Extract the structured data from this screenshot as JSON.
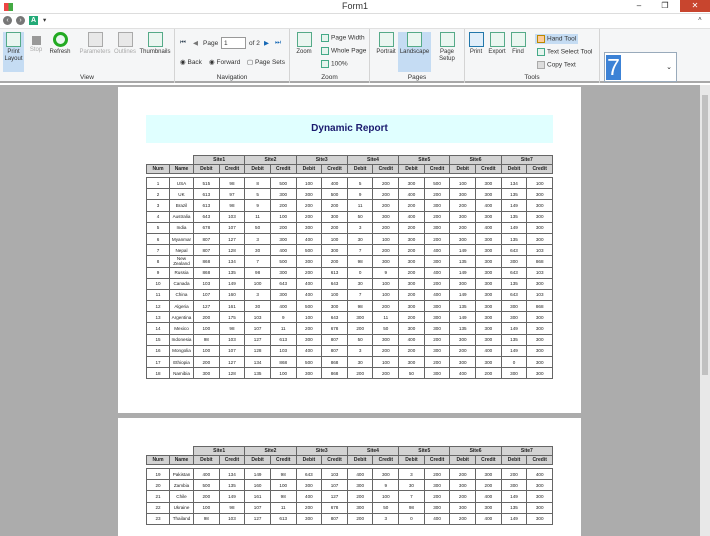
{
  "window": {
    "title": "Form1",
    "minimize": "–",
    "restore": "❐",
    "close": "✕"
  },
  "ribbon": {
    "view": {
      "label": "View",
      "print_layout": "Print Layout",
      "stop": "Stop",
      "refresh": "Refresh",
      "parameters": "Parameters",
      "outlines": "Outlines",
      "thumbnails": "Thumbnails"
    },
    "navigation": {
      "label": "Navigation",
      "page_label": "Page",
      "page_value": "1",
      "of_label": "of 2",
      "back": "Back",
      "forward": "Forward",
      "page_sets": "Page Sets"
    },
    "zoom": {
      "label": "Zoom",
      "zoom": "Zoom",
      "page_width": "Page Width",
      "whole_page": "Whole Page",
      "hundred": "100%"
    },
    "pages": {
      "label": "Pages",
      "portrait": "Portrait",
      "landscape": "Landscape",
      "page_setup": "Page Setup"
    },
    "tools": {
      "label": "Tools",
      "print": "Print",
      "export": "Export",
      "find": "Find",
      "hand_tool": "Hand Tool",
      "text_select": "Text Select Tool",
      "copy_text": "Copy Text"
    },
    "combo_value": "7"
  },
  "report": {
    "title": "Dynamic Report",
    "sites": [
      "Site1",
      "Site2",
      "Site3",
      "Site4",
      "Site5",
      "Site6",
      "Site7"
    ],
    "col_num": "Num",
    "col_name": "Name",
    "debit": "Debit",
    "credit": "Credit",
    "page1_rows": [
      [
        "1",
        "USA",
        "515",
        "98",
        "8",
        "500",
        "100",
        "400",
        "5",
        "200",
        "300",
        "500",
        "100",
        "300",
        "134",
        "100"
      ],
      [
        "2",
        "UK",
        "613",
        "97",
        "5",
        "300",
        "300",
        "500",
        "9",
        "200",
        "400",
        "200",
        "300",
        "300",
        "135",
        "300"
      ],
      [
        "3",
        "Brazil",
        "613",
        "98",
        "9",
        "200",
        "200",
        "200",
        "11",
        "200",
        "200",
        "300",
        "200",
        "400",
        "149",
        "300"
      ],
      [
        "4",
        "Australia",
        "643",
        "103",
        "11",
        "100",
        "200",
        "300",
        "50",
        "300",
        "400",
        "200",
        "300",
        "300",
        "135",
        "300"
      ],
      [
        "5",
        "India",
        "678",
        "107",
        "50",
        "200",
        "300",
        "200",
        "3",
        "200",
        "200",
        "300",
        "200",
        "400",
        "149",
        "300"
      ],
      [
        "6",
        "Myanmar",
        "807",
        "127",
        "3",
        "300",
        "400",
        "100",
        "30",
        "100",
        "300",
        "200",
        "300",
        "300",
        "135",
        "300"
      ],
      [
        "7",
        "Nepal",
        "807",
        "128",
        "30",
        "400",
        "500",
        "300",
        "7",
        "200",
        "200",
        "400",
        "149",
        "300",
        "643",
        "103"
      ],
      [
        "8",
        "New Zealand",
        "868",
        "134",
        "7",
        "500",
        "300",
        "200",
        "98",
        "300",
        "300",
        "300",
        "135",
        "300",
        "300",
        "868"
      ],
      [
        "9",
        "Russia",
        "868",
        "135",
        "98",
        "300",
        "200",
        "613",
        "0",
        "9",
        "200",
        "400",
        "149",
        "300",
        "643",
        "103"
      ],
      [
        "10",
        "Canada",
        "103",
        "149",
        "100",
        "643",
        "400",
        "643",
        "30",
        "100",
        "300",
        "200",
        "300",
        "300",
        "135",
        "300"
      ],
      [
        "11",
        "China",
        "107",
        "160",
        "3",
        "300",
        "400",
        "100",
        "7",
        "100",
        "200",
        "400",
        "149",
        "300",
        "643",
        "103"
      ],
      [
        "12",
        "Algeria",
        "127",
        "161",
        "30",
        "400",
        "500",
        "300",
        "98",
        "200",
        "300",
        "300",
        "135",
        "300",
        "300",
        "868"
      ],
      [
        "13",
        "Argentina",
        "200",
        "175",
        "103",
        "9",
        "100",
        "643",
        "300",
        "11",
        "200",
        "300",
        "149",
        "300",
        "300",
        "300"
      ],
      [
        "14",
        "Mexico",
        "100",
        "98",
        "107",
        "11",
        "200",
        "678",
        "200",
        "50",
        "300",
        "300",
        "135",
        "300",
        "149",
        "300"
      ],
      [
        "15",
        "Indonesia",
        "98",
        "103",
        "127",
        "613",
        "300",
        "807",
        "50",
        "300",
        "400",
        "200",
        "300",
        "300",
        "135",
        "300"
      ],
      [
        "16",
        "Mongolia",
        "100",
        "107",
        "128",
        "103",
        "400",
        "807",
        "3",
        "200",
        "200",
        "300",
        "200",
        "400",
        "149",
        "300"
      ],
      [
        "17",
        "Ethiopia",
        "200",
        "127",
        "134",
        "868",
        "500",
        "868",
        "30",
        "100",
        "300",
        "200",
        "300",
        "300",
        "0",
        "300"
      ],
      [
        "18",
        "Namibia",
        "300",
        "128",
        "135",
        "100",
        "300",
        "868",
        "200",
        "200",
        "50",
        "300",
        "400",
        "200",
        "300",
        "300"
      ]
    ],
    "page2_rows": [
      [
        "19",
        "Pakistan",
        "400",
        "134",
        "149",
        "98",
        "643",
        "103",
        "400",
        "300",
        "3",
        "200",
        "200",
        "300",
        "200",
        "400"
      ],
      [
        "20",
        "Zambia",
        "500",
        "135",
        "160",
        "100",
        "300",
        "107",
        "300",
        "9",
        "30",
        "300",
        "300",
        "200",
        "300",
        "300"
      ],
      [
        "21",
        "Chile",
        "200",
        "149",
        "161",
        "98",
        "400",
        "127",
        "200",
        "100",
        "7",
        "200",
        "200",
        "400",
        "149",
        "300"
      ],
      [
        "22",
        "Ukraine",
        "100",
        "98",
        "107",
        "11",
        "200",
        "678",
        "300",
        "50",
        "98",
        "300",
        "300",
        "300",
        "135",
        "300"
      ],
      [
        "23",
        "Thailand",
        "98",
        "103",
        "127",
        "613",
        "300",
        "807",
        "200",
        "3",
        "0",
        "400",
        "200",
        "400",
        "149",
        "300"
      ]
    ]
  }
}
